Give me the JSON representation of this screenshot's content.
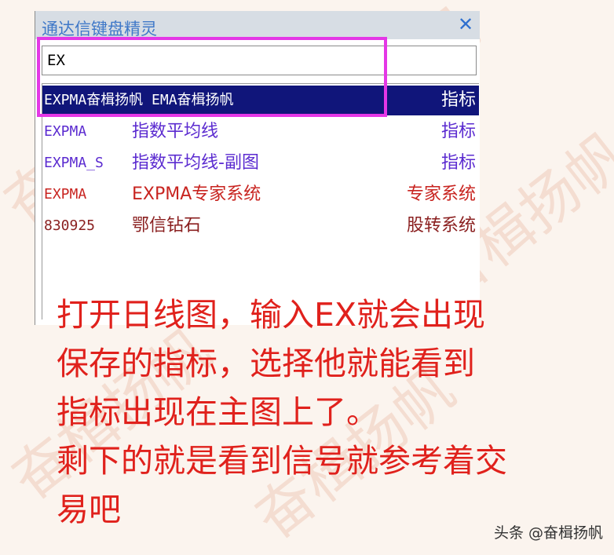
{
  "watermark": "奋楫扬帆",
  "window": {
    "title": "通达信键盘精灵",
    "close_icon": "close-icon",
    "search_value": "EX"
  },
  "results": [
    {
      "code": "EXPMA奋楫扬帆 EMA奋楫扬帆",
      "name": "",
      "type": "指标",
      "style": "selected"
    },
    {
      "code": "EXPMA",
      "name": "指数平均线",
      "type": "指标",
      "style": "blue"
    },
    {
      "code": "EXPMA_S",
      "name": "指数平均线-副图",
      "type": "指标",
      "style": "blue"
    },
    {
      "code": "EXPMA",
      "name": "EXPMA专家系统",
      "type": "专家系统",
      "style": "red"
    },
    {
      "code": "830925",
      "name": "鄂信钻石",
      "type": "股转系统",
      "style": "dark"
    }
  ],
  "instructions": {
    "line1": "打开日线图，输入EX就会出现",
    "line2": "保存的指标，选择他就能看到",
    "line3": "指标出现在主图上了。",
    "line4": "剩下的就是看到信号就参考着交",
    "line5": "易吧"
  },
  "footer": "头条 @奋楫扬帆"
}
